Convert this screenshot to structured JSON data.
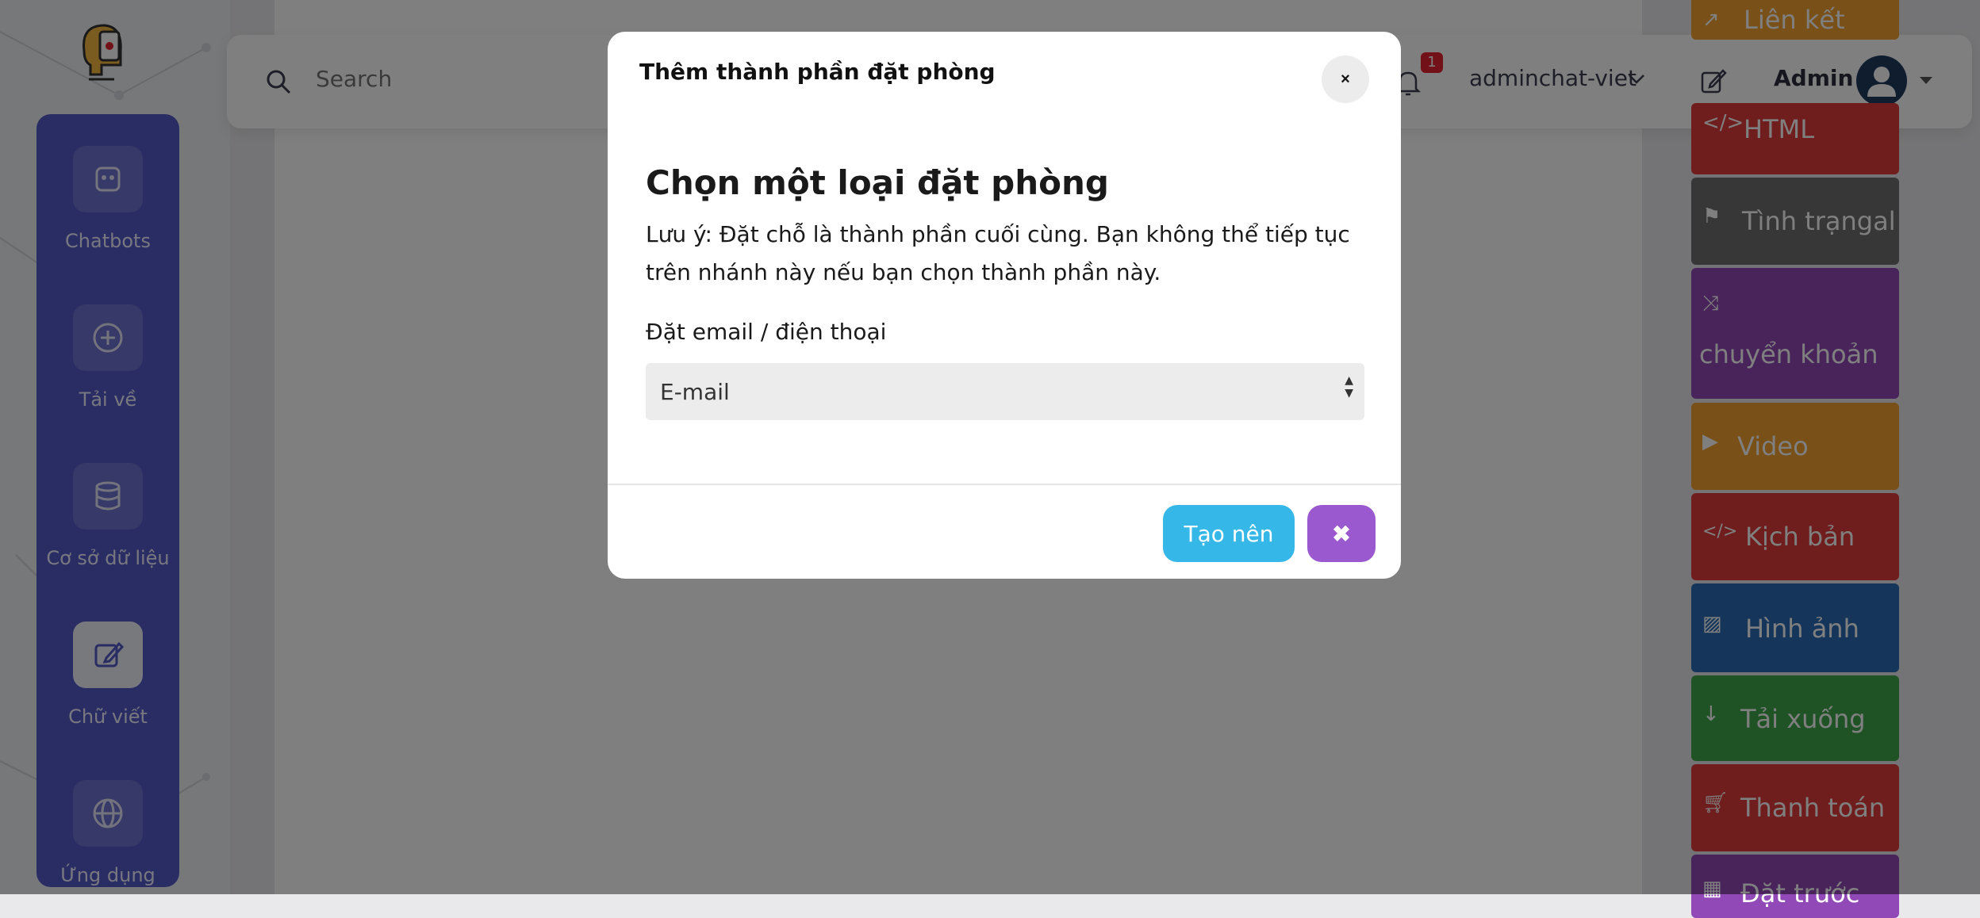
{
  "sidebar": {
    "items": [
      {
        "label": "Chatbots",
        "icon": "robot-icon"
      },
      {
        "label": "Tải về",
        "icon": "plus-circle-icon"
      },
      {
        "label": "Cơ sở dữ liệu",
        "icon": "database-icon"
      },
      {
        "label": "Chữ viết",
        "icon": "edit-icon",
        "active": true
      },
      {
        "label": "Ứng dụng",
        "icon": "globe-icon"
      }
    ]
  },
  "topbar": {
    "search_placeholder": "Search",
    "notification_count": "1",
    "account_name": "adminchat-viet",
    "user_label": "Admin"
  },
  "palette": {
    "items": [
      {
        "label": "Liên kết",
        "color": "#f0a030",
        "icon": "external-link-icon"
      },
      {
        "label": "HTML",
        "color": "#e03a3a",
        "icon": "code-icon"
      },
      {
        "label": "Tình trạngal",
        "color": "#6e6e6e",
        "icon": "signpost-icon"
      },
      {
        "label": "chuyển khoản",
        "color": "#9049b7",
        "icon": "shuffle-icon"
      },
      {
        "label": "Video",
        "color": "#f0a030",
        "icon": "play-icon"
      },
      {
        "label": "Kịch bản",
        "color": "#e03a3a",
        "icon": "code-icon"
      },
      {
        "label": "Hình ảnh",
        "color": "#2a6db5",
        "icon": "image-icon"
      },
      {
        "label": "Tải xuống",
        "color": "#3fa64a",
        "icon": "arrow-down-icon"
      },
      {
        "label": "Thanh toán",
        "color": "#e03a3a",
        "icon": "cart-icon"
      },
      {
        "label": "Đặt trước",
        "color": "#9049b7",
        "icon": "calendar-icon"
      }
    ]
  },
  "modal": {
    "title": "Thêm thành phần đặt phòng",
    "heading": "Chọn một loại đặt phòng",
    "note": "Lưu ý: Đặt chỗ là thành phần cuối cùng. Bạn không thể tiếp tục trên nhánh này nếu bạn chọn thành phần này.",
    "field_label": "Đặt email / điện thoại",
    "select_value": "E-mail",
    "create_label": "Tạo nên",
    "close_glyph": "×",
    "cancel_glyph": "✖"
  }
}
